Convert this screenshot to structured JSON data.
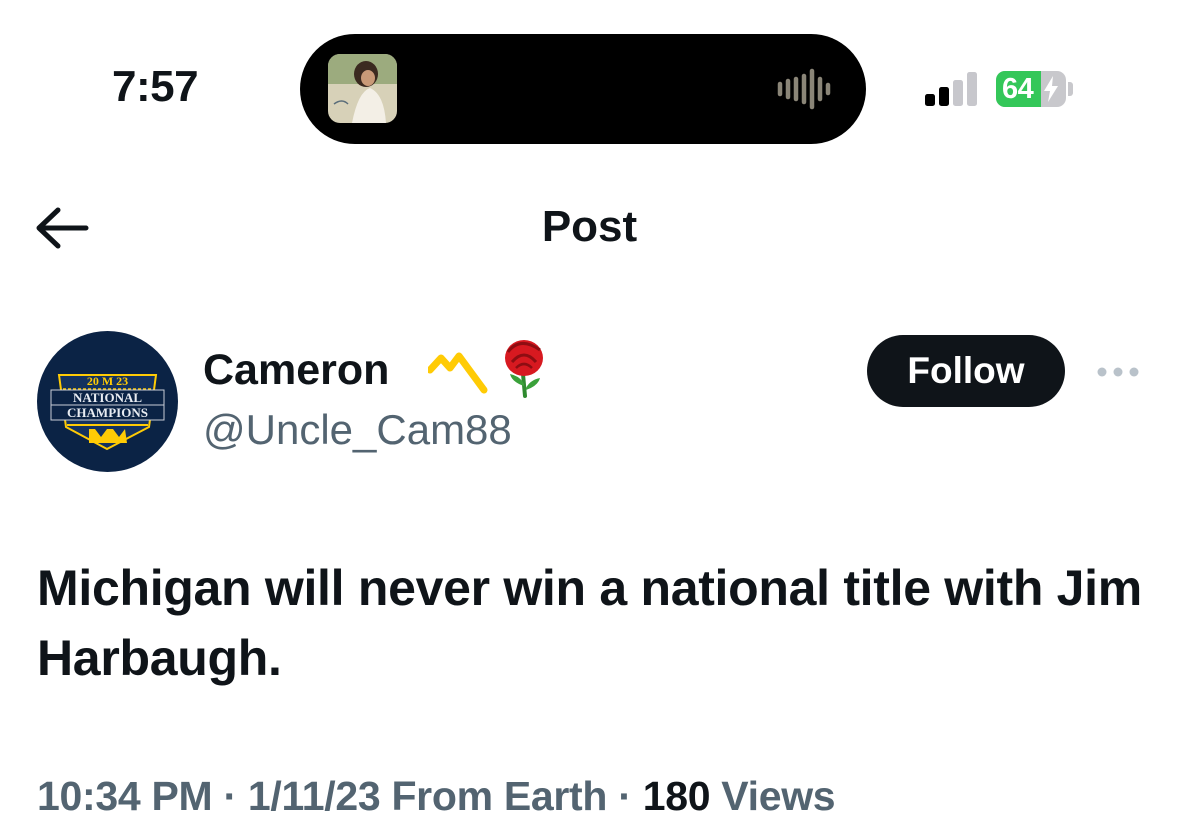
{
  "status_bar": {
    "time": "7:57",
    "battery": "64",
    "battery_level_percent": 64,
    "battery_charging": true,
    "signal_bars_active": 2,
    "now_playing_icon": "audio-waveform-icon"
  },
  "nav": {
    "back_icon": "arrow-left-icon",
    "title": "Post"
  },
  "author": {
    "display_name": "Cameron",
    "badges": [
      "michigan-m-icon",
      "rose-icon"
    ],
    "handle": "@Uncle_Cam88",
    "avatar_text": {
      "top": "20 M 23",
      "line1": "NATIONAL",
      "line2": "CHAMPIONS"
    },
    "follow_label": "Follow",
    "more_icon": "more-horizontal-icon"
  },
  "post": {
    "text": "Michigan will never win a national title with Jim Harbaugh.",
    "time": "10:34 PM",
    "date": "1/11/23",
    "location": "From Earth",
    "views": "180",
    "views_label": "Views",
    "separator": "·"
  },
  "colors": {
    "text_primary": "#0f1419",
    "text_secondary": "#536471",
    "battery_green": "#34c759",
    "avatar_navy": "#0b2345",
    "maize": "#ffcb05"
  }
}
